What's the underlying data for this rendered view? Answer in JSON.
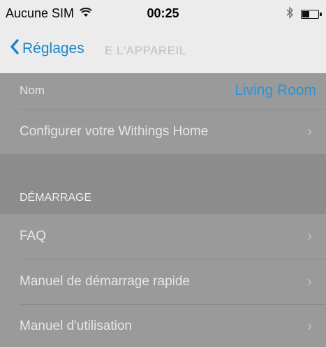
{
  "status_bar": {
    "carrier": "Aucune SIM",
    "time": "00:25",
    "icons": [
      "wifi-icon",
      "bluetooth-icon",
      "battery-icon"
    ]
  },
  "nav": {
    "back_label": "Réglages",
    "title": "E L'APPAREIL"
  },
  "device": {
    "name_label": "Nom",
    "name_value": "Living Room",
    "configure_label": "Configurer votre Withings Home"
  },
  "startup": {
    "header": "DÉMARRAGE",
    "items": [
      {
        "label": "FAQ"
      },
      {
        "label": "Manuel de démarrage rapide"
      },
      {
        "label": "Manuel d'utilisation"
      }
    ]
  },
  "colors": {
    "accent": "#1a87c8",
    "overlay": "#9a9a9a"
  }
}
